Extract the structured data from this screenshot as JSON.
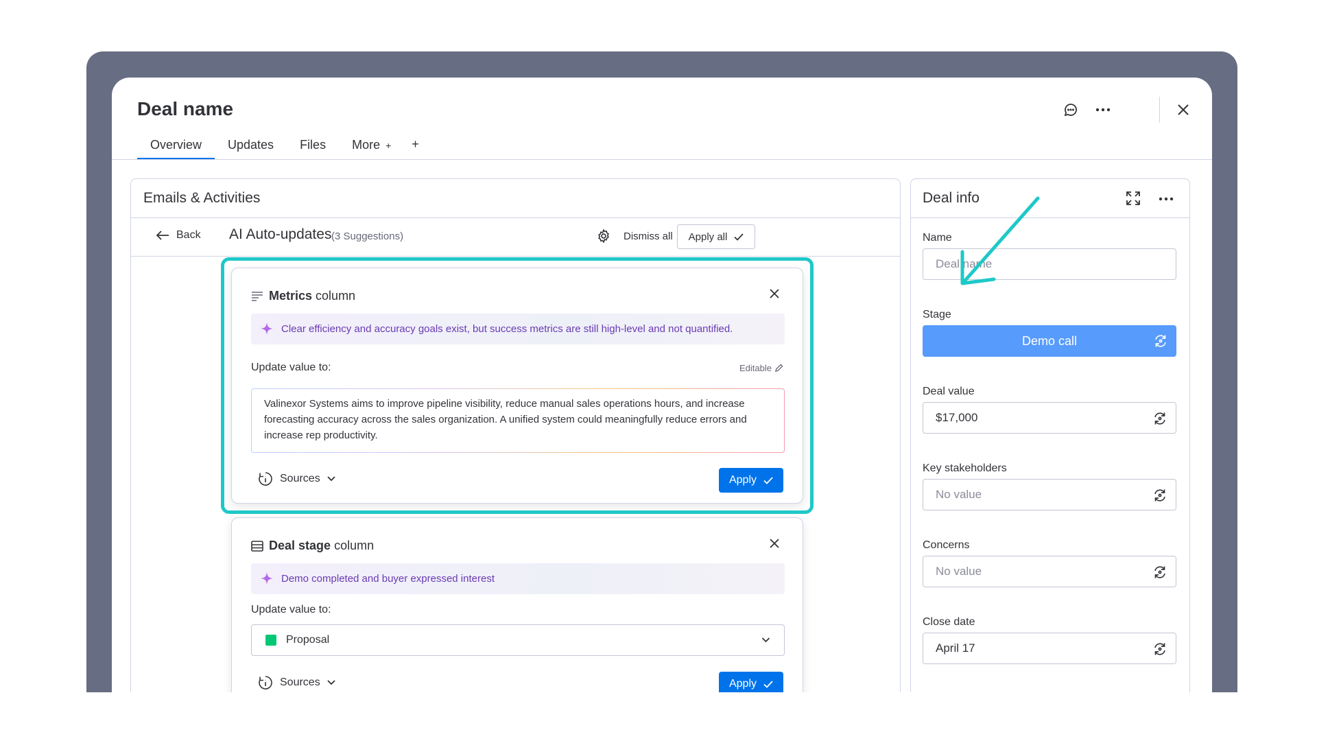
{
  "header": {
    "title": "Deal name"
  },
  "tabs": [
    {
      "label": "Overview",
      "active": true
    },
    {
      "label": "Updates"
    },
    {
      "label": "Files"
    },
    {
      "label": "More"
    }
  ],
  "left_panel": {
    "title": "Emails & Activities",
    "back_label": "Back",
    "ai_title": "AI Auto-updates",
    "suggestions_count": "(3 Suggestions)",
    "dismiss_all": "Dismiss all",
    "apply_all": "Apply all"
  },
  "cards": [
    {
      "column_prefix": "Metrics",
      "column_suffix": "column",
      "ai_reason": "Clear efficiency and accuracy goals exist, but success metrics are still high-level and not quantified.",
      "update_label": "Update value to:",
      "editable_label": "Editable",
      "value": "Valinexor Systems aims to improve pipeline visibility, reduce manual sales operations hours, and increase forecasting accuracy across the sales organization. A unified system could meaningfully reduce errors and increase rep productivity.",
      "sources_label": "Sources",
      "apply_label": "Apply"
    },
    {
      "column_prefix": "Deal stage",
      "column_suffix": "column",
      "ai_reason": "Demo completed and buyer expressed interest",
      "update_label": "Update value to:",
      "value": "Proposal",
      "value_color": "#00c875",
      "sources_label": "Sources",
      "apply_label": "Apply"
    }
  ],
  "deal_info": {
    "title": "Deal info",
    "fields": [
      {
        "label": "Name",
        "placeholder": "Deal name"
      },
      {
        "label": "Stage",
        "value": "Demo call",
        "color": "#579bfc"
      },
      {
        "label": "Deal value",
        "value": "$17,000"
      },
      {
        "label": "Key stakeholders",
        "placeholder": "No value"
      },
      {
        "label": "Concerns",
        "placeholder": "No value"
      },
      {
        "label": "Close date",
        "value": "April 17"
      }
    ]
  },
  "colors": {
    "accent": "#0073ea",
    "highlight": "#1fc8c8",
    "ai_text": "#6a3ab2"
  }
}
